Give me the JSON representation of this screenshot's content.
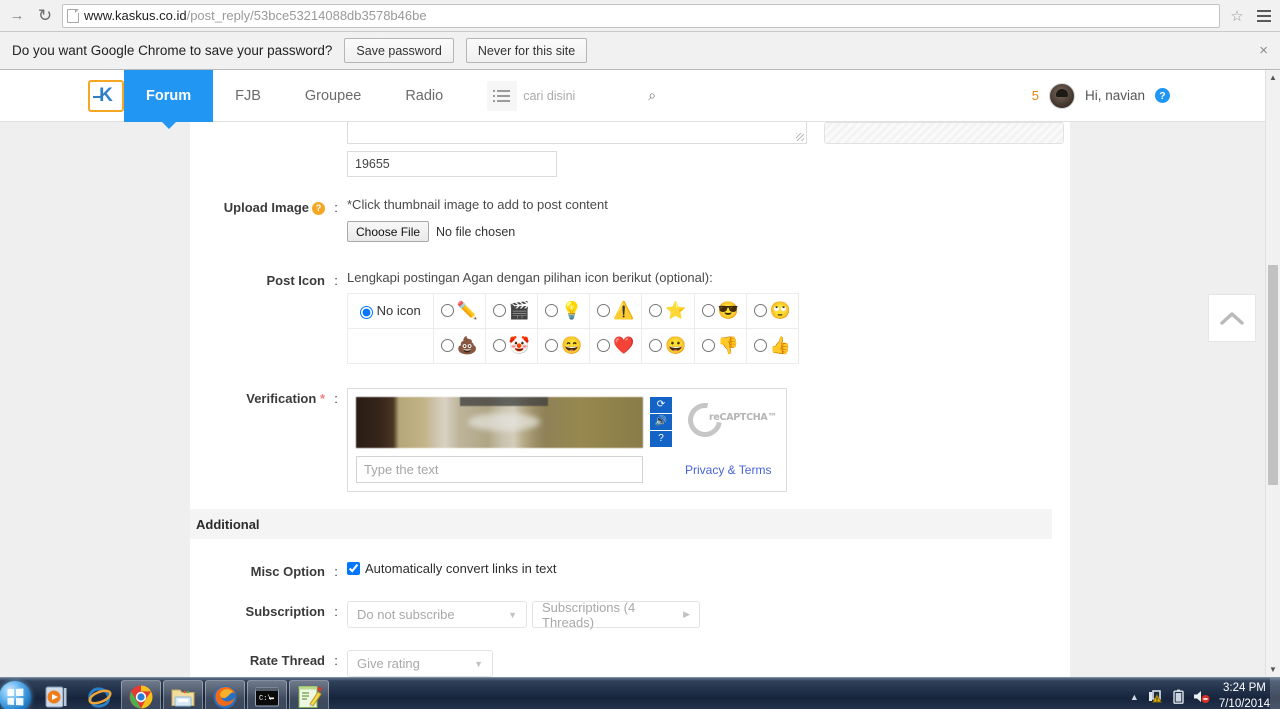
{
  "browser": {
    "forward_icon": "forward-arrow-icon",
    "reload_icon": "reload-icon",
    "url_domain": "www.kaskus.co.id",
    "url_path": "/post_reply/53bce53214088db3578b46be",
    "star_icon": "☆",
    "menu_icon": "hamburger-menu-icon"
  },
  "password_bar": {
    "message": "Do you want Google Chrome to save your password?",
    "save_label": "Save password",
    "never_label": "Never for this site",
    "close_label": "×"
  },
  "site_header": {
    "logo_text": "K",
    "tabs": [
      {
        "label": "Forum",
        "active": true
      },
      {
        "label": "FJB",
        "active": false
      },
      {
        "label": "Groupee",
        "active": false
      },
      {
        "label": "Radio",
        "active": false
      }
    ],
    "search_placeholder": "cari disini",
    "search_icon": "⌕",
    "list_icon": "list-icon",
    "notification_count": "5",
    "greeting": "Hi, navian",
    "help_icon": "?",
    "accent_color": "#2196f3",
    "logo_border_color": "#f5a623"
  },
  "form": {
    "char_count": "19655",
    "upload": {
      "label": "Upload Image",
      "help_icon": "?",
      "colon": ":",
      "hint": "*Click thumbnail image to add to post content",
      "choose_file_label": "Choose File",
      "no_file_label": "No file chosen"
    },
    "post_icon": {
      "label": "Post Icon",
      "colon": ":",
      "hint": "Lengkapi postingan Agan dengan pilihan icon berikut (optional):",
      "no_icon_label": "No icon",
      "row1": [
        {
          "name": "pencil-icon",
          "glyph": "✏️"
        },
        {
          "name": "clapperboard-icon",
          "glyph": "🎬"
        },
        {
          "name": "lightbulb-icon",
          "glyph": "💡"
        },
        {
          "name": "warning-icon",
          "glyph": "⚠️"
        },
        {
          "name": "star-icon",
          "glyph": "⭐"
        },
        {
          "name": "sunglasses-face-icon",
          "glyph": "😎"
        },
        {
          "name": "smiley-icon",
          "glyph": "🙄"
        }
      ],
      "row2": [
        {
          "name": "poop-icon",
          "glyph": "💩"
        },
        {
          "name": "clown-face-icon",
          "glyph": "🤡"
        },
        {
          "name": "laughing-face-icon",
          "glyph": "😄"
        },
        {
          "name": "heart-icon",
          "glyph": "❤️"
        },
        {
          "name": "blue-face-icon",
          "glyph": "😀"
        },
        {
          "name": "thumbs-down-icon",
          "glyph": "👎"
        },
        {
          "name": "thumbs-up-icon",
          "glyph": "👍"
        }
      ]
    },
    "verification": {
      "label": "Verification",
      "required_mark": "*",
      "colon": ":",
      "input_placeholder": "Type the text",
      "refresh_icon": "⟳",
      "audio_icon": "🔊",
      "help_icon": "?",
      "recaptcha_word": "reCAPTCHA™",
      "privacy_label": "Privacy & Terms",
      "button_color": "#1464c8",
      "link_color": "#4a62d8"
    }
  },
  "additional": {
    "heading": "Additional",
    "misc_option": {
      "label": "Misc Option",
      "colon": ":",
      "checkbox_label": "Automatically convert links in text",
      "checked": true
    },
    "subscription": {
      "label": "Subscription",
      "colon": ":",
      "select_value": "Do not subscribe",
      "threads_button": "Subscriptions (4 Threads)"
    },
    "rate_thread": {
      "label": "Rate Thread",
      "colon": ":",
      "select_value": "Give rating"
    }
  },
  "scroll_top": {
    "icon": "⌃",
    "name": "scroll-to-top-button"
  },
  "taskbar": {
    "start_label": "start-orb",
    "items": [
      {
        "name": "windows-media-player-icon",
        "open": false
      },
      {
        "name": "internet-explorer-icon",
        "open": false
      },
      {
        "name": "google-chrome-icon",
        "open": true
      },
      {
        "name": "file-explorer-icon",
        "open": true
      },
      {
        "name": "firefox-icon",
        "open": true
      },
      {
        "name": "command-prompt-icon",
        "open": true
      },
      {
        "name": "notepad-plus-plus-icon",
        "open": true
      }
    ],
    "tray": {
      "expand_icon": "▲",
      "network_icon": "network-warning-icon",
      "battery_icon": "battery-icon",
      "volume_icon": "volume-muted-icon"
    },
    "time": "3:24 PM",
    "date": "7/10/2014"
  }
}
